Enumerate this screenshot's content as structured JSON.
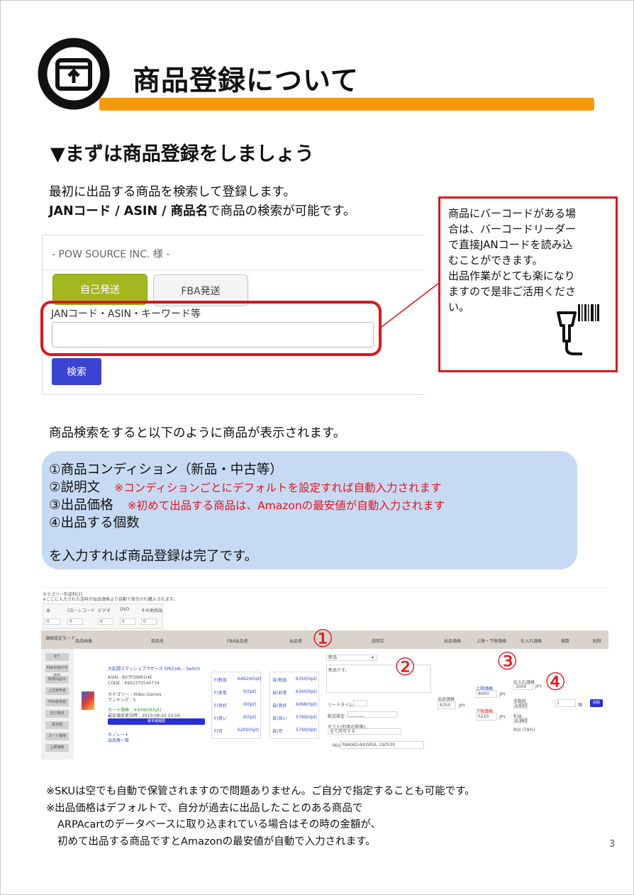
{
  "header": {
    "title": "商品登録について",
    "icon": "box-icon"
  },
  "section": {
    "heading": "▼まずは商品登録をしましょう"
  },
  "intro": {
    "line1": "最初に出品する商品を検索して登録します。",
    "line2_bold": "JANコード / ASIN / 商品名",
    "line2_rest": "で商品の検索が可能です。"
  },
  "search_panel": {
    "store_name": "- POW SOURCE INC. 様 -",
    "tab_self": "自己発送",
    "tab_fba": "FBA発送",
    "field_label": "JANコード・ASIN・キーワード等",
    "search_button": "検索"
  },
  "note": {
    "lines": [
      "商品にバーコードがある場",
      "合は、バーコードリーダー",
      "で直接JANコードを読み込",
      "むことができます。",
      "出品作業がとても楽になり",
      "ますので是非ご活用くださ",
      "い。"
    ],
    "icon": "barcode-scanner-icon"
  },
  "result_intro": "商品検索をすると以下のように商品が表示されます。",
  "steps": {
    "s1": "①商品コンディション（新品・中古等）",
    "s2": "②説明文",
    "s2_note": "※コンディションごとにデフォルトを設定すれば自動入力されます",
    "s3": "③出品価格",
    "s3_note": "※初めて出品する商品は、Amazonの最安値が自動入力されます",
    "s4": "④出品する個数",
    "done": "を入力すれば商品登録は完了です。"
  },
  "listing": {
    "top_lines": [
      "カテゴリー別送料[ii]",
      "※ここに入力された送料が出品価格より自動で差引かれ購入されます。"
    ],
    "category_headers": [
      "本",
      "CD・レコード",
      "ビデオ",
      "DVD",
      "その他商品"
    ],
    "category_values": [
      "0",
      "0",
      "0",
      "0",
      "0"
    ],
    "columns": [
      "価格設定モード",
      "商品画像",
      "商品名",
      "FBA出品者",
      "出品者",
      "説明文",
      "出品価格",
      "上限・下限価格",
      "仕入れ価格",
      "個数",
      "削除"
    ],
    "side_buttons": [
      "全て",
      "FBA出荷の可能性",
      "新規出品中",
      "上位販売者",
      "FBA最安値",
      "自己発送",
      "最安値",
      "カート獲得",
      "上限価格"
    ],
    "product": {
      "title": "大乱闘スマッシュブラザーズ SPECIAL - Switch",
      "asin": "ASIN : B07FDWR1HK",
      "code": "CODE : 4902370540734",
      "category": "カテゴリー : Video Games",
      "ranking": "ランキング : 5",
      "cart_price": "カート価格 : ￥6492(65pt)",
      "last_change": "最安値変更日時 : 2019-08-20 10:56",
      "history_button": "最安値履歴",
      "monorate": "モノレート",
      "offers": "出品者一覧"
    },
    "fba_rows": [
      {
        "label": "F(新品",
        "value": "6492(65pt)"
      },
      {
        "label": "F(非常",
        "value": "0(0pt)"
      },
      {
        "label": "F(良好",
        "value": "0(0pt)"
      },
      {
        "label": "F(良い",
        "value": "0(0pt)"
      },
      {
        "label": "F(可",
        "value": "6200(0pt)"
      }
    ],
    "seller_rows": [
      {
        "label": "自(新品",
        "value": "6350(0pt)"
      },
      {
        "label": "自(非常",
        "value": "6340(0pt)"
      },
      {
        "label": "自(良好",
        "value": "6098(0pt)"
      },
      {
        "label": "自(良い",
        "value": "5799(0pt)"
      },
      {
        "label": "自(可",
        "value": "5790(0pt)"
      }
    ],
    "condition_select": "新品",
    "description": "新品です。",
    "lead_time": "リードタイム :",
    "shipping_setting": "配送設定 : ----------",
    "gift_label": "ギフト(利用の制限):",
    "gift_value": "全て許可する",
    "sku_label": "SKU :",
    "sku_value": "MAKAD-NXGRUL-190530",
    "price_label": "出品価格",
    "price_value": "6350",
    "currency": "JPY",
    "upper_label": "上限価格",
    "upper_value": "8000",
    "lower_label": "下限価格",
    "lower_value": "6220",
    "cost_label": "仕入れ価格",
    "cost_value": "3000",
    "fee_label": "手数料",
    "fee_value": "1,037",
    "profit_label": "利益",
    "profit_value": "2,363",
    "roi": "ROI (79%)",
    "quantity": "1",
    "quantity_unit": "個",
    "delete_button": "削除",
    "markers": [
      "①",
      "②",
      "③",
      "④"
    ]
  },
  "footnotes": [
    "※SKUは空でも自動で保管されますので問題ありません。ご自分で指定することも可能です。",
    "※出品価格はデフォルトで、自分が過去に出品したことのある商品で",
    "ARPAcartのデータベースに取り込まれている場合はその時の金額が、",
    "初めて出品する商品ですとAmazonの最安値が自動で入力されます。"
  ],
  "page_number": "3",
  "colors": {
    "accent_orange": "#f49a0c",
    "highlight_red": "#e0141a",
    "panel_blue": "#c7daf4",
    "tab_green": "#a3b71f",
    "button_blue": "#3b43d2"
  }
}
